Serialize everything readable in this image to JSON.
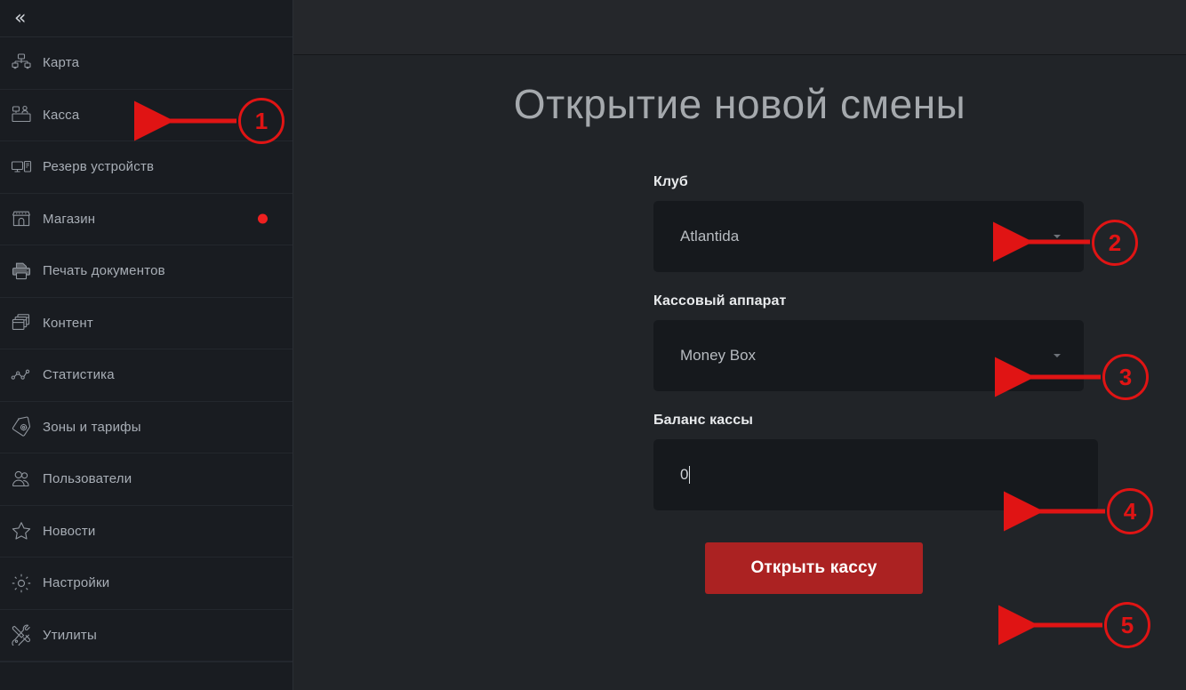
{
  "sidebar": {
    "collapse_glyph": "«",
    "items": [
      {
        "label": "Карта",
        "icon": "network-map-icon",
        "badge_dot": false
      },
      {
        "label": "Касса",
        "icon": "cash-desk-icon",
        "badge_dot": false
      },
      {
        "label": "Резерв устройств",
        "icon": "monitor-tower-icon",
        "badge_dot": false
      },
      {
        "label": "Магазин",
        "icon": "shop-icon",
        "badge_dot": true
      },
      {
        "label": "Печать документов",
        "icon": "printer-icon",
        "badge_dot": false
      },
      {
        "label": "Контент",
        "icon": "windows-stack-icon",
        "badge_dot": false
      },
      {
        "label": "Статистика",
        "icon": "line-chart-icon",
        "badge_dot": false
      },
      {
        "label": "Зоны и тарифы",
        "icon": "tag-gear-icon",
        "badge_dot": false
      },
      {
        "label": "Пользователи",
        "icon": "users-icon",
        "badge_dot": false
      },
      {
        "label": "Новости",
        "icon": "star-icon",
        "badge_dot": false
      },
      {
        "label": "Настройки",
        "icon": "gear-icon",
        "badge_dot": false
      },
      {
        "label": "Утилиты",
        "icon": "tools-icon",
        "badge_dot": false
      }
    ]
  },
  "main": {
    "title": "Открытие новой смены",
    "fields": {
      "club": {
        "label": "Клуб",
        "value": "Atlantida"
      },
      "register": {
        "label": "Кассовый аппарат",
        "value": "Money Box"
      },
      "balance": {
        "label": "Баланс кассы",
        "value": "0"
      }
    },
    "submit_label": "Открыть кассу"
  },
  "annotations": {
    "accent_color": "#e01414",
    "badges": [
      {
        "number": "1"
      },
      {
        "number": "2"
      },
      {
        "number": "3"
      },
      {
        "number": "4"
      },
      {
        "number": "5"
      }
    ]
  },
  "colors": {
    "sidebar_bg": "#191c21",
    "content_bg": "#212428",
    "topbar_bg": "#25272b",
    "field_bg": "#16191d",
    "button_red": "#ab2222",
    "dot_red": "#ef2020",
    "annotation_red": "#e01414"
  }
}
